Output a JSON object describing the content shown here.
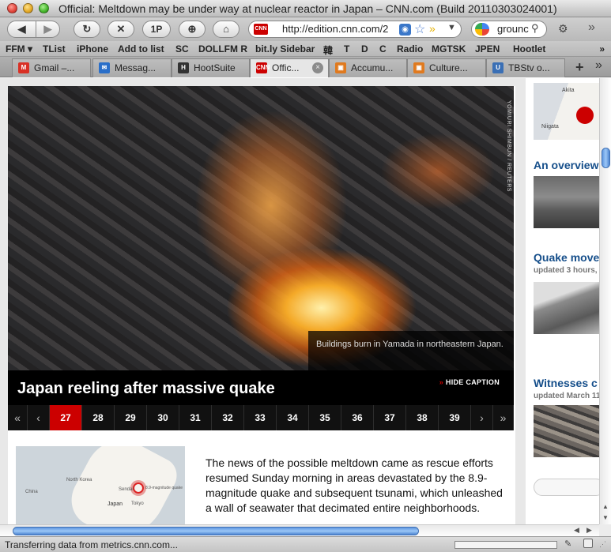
{
  "window": {
    "title": "Official: Meltdown may be under way at nuclear reactor in Japan – CNN.com (Build 20110303024001)"
  },
  "toolbar": {
    "back": "◀",
    "forward": "▶",
    "reload": "↻",
    "stop": "✕",
    "onepassword": "1P",
    "bookmark": "⊕",
    "home": "⌂",
    "url_favicon": "CNN",
    "url": "http://edition.cnn.com/2",
    "search_query": "grounc",
    "search_glyph": "⚲",
    "gear": "⚙",
    "overflow": "»"
  },
  "bookmarks": [
    {
      "label": "FFM ▾"
    },
    {
      "label": "TList"
    },
    {
      "label": "iPhone"
    },
    {
      "label": "Add to list"
    },
    {
      "label": "SC"
    },
    {
      "label": "DOLLFM R"
    },
    {
      "label": "bit.ly Sidebar"
    },
    {
      "label": "韓"
    },
    {
      "label": "T"
    },
    {
      "label": "D"
    },
    {
      "label": "C"
    },
    {
      "label": "Radio"
    },
    {
      "label": "MGTSK"
    },
    {
      "label": "JPEN"
    },
    {
      "label": "Hootlet"
    }
  ],
  "bookmarks_overflow": "»",
  "tabs": [
    {
      "label": "Gmail –...",
      "favicon": "M",
      "color": "#d93025"
    },
    {
      "label": "Messag...",
      "favicon": "✉",
      "color": "#2a6fc9"
    },
    {
      "label": "HootSuite",
      "favicon": "H",
      "color": "#333"
    },
    {
      "label": "Offic...",
      "favicon": "CNN",
      "color": "#cc0000"
    },
    {
      "label": "Accumu...",
      "favicon": "▣",
      "color": "#e07a1f"
    },
    {
      "label": "Culture...",
      "favicon": "▣",
      "color": "#e07a1f"
    },
    {
      "label": "TBStv o...",
      "favicon": "U",
      "color": "#3a6fb5"
    }
  ],
  "tab_add": "+",
  "tab_list": "»",
  "tab_close_glyph": "×",
  "gallery": {
    "credit": "YOMIURI SHIMBUN / REUTERS",
    "caption": "Buildings burn in Yamada in northeastern Japan.",
    "headline": "Japan reeling after massive quake",
    "hide_caption": "HIDE CAPTION",
    "hide_caption_marker": "»",
    "first": "«",
    "prev": "‹",
    "next": "›",
    "last": "»",
    "pages": [
      "27",
      "28",
      "29",
      "30",
      "31",
      "32",
      "33",
      "34",
      "35",
      "36",
      "37",
      "38",
      "39"
    ],
    "selected_page": "27"
  },
  "article": {
    "map": {
      "china": "China",
      "korea": "North Korea",
      "japan": "Japan",
      "tokyo": "Tokyo",
      "sendai": "Sendai",
      "quake": "8.9-magnitude quake"
    },
    "text": "The news of the possible meltdown came as rescue efforts resumed Sunday morning in areas devastated by the 8.9-magnitude quake and subsequent tsunami, which unleashed a wall of seawater that decimated entire neighborhoods."
  },
  "sidebar": {
    "map_labels": {
      "a": "Akita",
      "b": "Niigata"
    },
    "items": [
      {
        "title": "An overview",
        "meta": ""
      },
      {
        "title": "Quake move",
        "meta": "updated 3 hours,"
      },
      {
        "title": "Witnesses c",
        "meta": "updated March 11"
      }
    ]
  },
  "scrollbars": {
    "up": "▲",
    "down": "▼",
    "left": "◀",
    "right": "▶"
  },
  "status": {
    "text": "Transferring data from metrics.cnn.com...",
    "icon1": "✎",
    "grip": "⋰"
  }
}
